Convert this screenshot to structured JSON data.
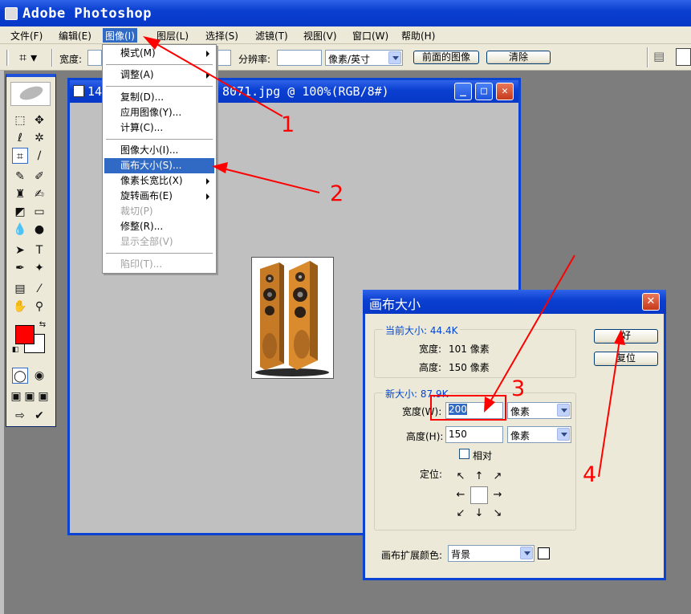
{
  "app": {
    "title": "Adobe Photoshop"
  },
  "menubar": {
    "items": [
      {
        "label": "文件(F)"
      },
      {
        "label": "编辑(E)"
      },
      {
        "label": "图像(I)"
      },
      {
        "label": "图层(L)"
      },
      {
        "label": "选择(S)"
      },
      {
        "label": "滤镜(T)"
      },
      {
        "label": "视图(V)"
      },
      {
        "label": "窗口(W)"
      },
      {
        "label": "帮助(H)"
      }
    ]
  },
  "optionsbar": {
    "width_label": "宽度:",
    "resolution_label": "分辨率:",
    "unit_select": "像素/英寸",
    "front_image_button": "前面的图像",
    "clear_button": "清除"
  },
  "image_menu": {
    "items": [
      {
        "label": "模式(M)",
        "submenu": true
      },
      {
        "label": "调整(A)",
        "submenu": true
      },
      {
        "label": "复制(D)..."
      },
      {
        "label": "应用图像(Y)..."
      },
      {
        "label": "计算(C)..."
      },
      {
        "label": "图像大小(I)..."
      },
      {
        "label": "画布大小(S)...",
        "highlighted": true
      },
      {
        "label": "像素长宽比(X)",
        "submenu": true
      },
      {
        "label": "旋转画布(E)",
        "submenu": true
      },
      {
        "label": "裁切(P)",
        "disabled": true
      },
      {
        "label": "修整(R)..."
      },
      {
        "label": "显示全部(V)",
        "disabled": true
      },
      {
        "label": "陷印(T)...",
        "disabled": true
      }
    ]
  },
  "document": {
    "title_left": "14",
    "title_right": "8071.jpg @ 100%(RGB/8#)"
  },
  "dialog": {
    "title": "画布大小",
    "current_size_label": "当前大小: 44.4K",
    "current_width_label": "宽度:",
    "current_width_value": "101 像素",
    "current_height_label": "高度:",
    "current_height_value": "150 像素",
    "new_size_label": "新大小: 87.9K",
    "width_label": "宽度(W):",
    "width_value": "200",
    "width_unit": "像素",
    "height_label": "高度(H):",
    "height_value": "150",
    "height_unit": "像素",
    "relative_label": "相对",
    "anchor_label": "定位:",
    "ext_color_label": "画布扩展颜色:",
    "ext_color_value": "背景",
    "ok_button": "好",
    "reset_button": "复位"
  },
  "annotations": [
    "1",
    "2",
    "3",
    "4"
  ],
  "colors": {
    "foreground": "#ff0000",
    "background": "#ffffff",
    "annotation": "#ff0000",
    "titlebar": "#0a3fd0"
  }
}
